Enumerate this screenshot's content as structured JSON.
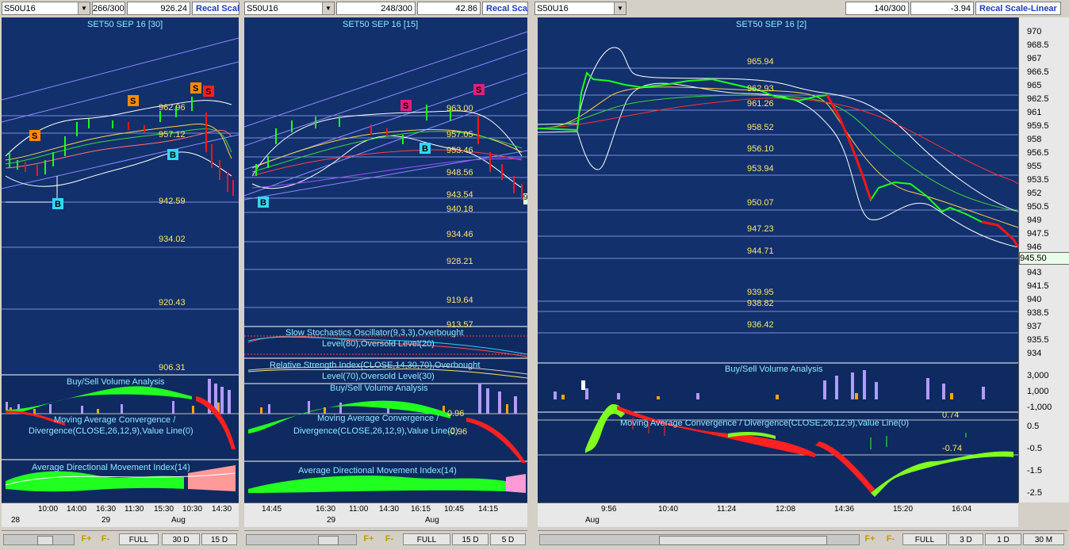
{
  "panels": [
    {
      "symbol": "S50U16",
      "count": "266/300",
      "last": "926.24",
      "recal": "Recal Scale",
      "title": "SET50 SEP 16  [30]",
      "levels": [
        "962.96",
        "957.12",
        "942.59",
        "934.02",
        "920.43",
        "906.31"
      ],
      "signals": [
        "S",
        "S",
        "S",
        "S",
        "B",
        "B"
      ],
      "sub1": "Buy/Sell Volume Analysis",
      "sub2a": "Moving Average Convergence /",
      "sub2b": "Divergence(CLOSE,26,12,9),Value Line(0)",
      "sub3": "Average Directional Movement Index(14)",
      "times": [
        "10:00",
        "14:00",
        "16:30",
        "11:30",
        "15:30",
        "10:30",
        "14:30"
      ],
      "dates": [
        "28",
        "29",
        "Aug"
      ],
      "buttons": [
        "FULL",
        "30 D",
        "15 D"
      ]
    },
    {
      "symbol": "S50U16",
      "count": "248/300",
      "last": "42.86",
      "recal": "Recal Scale",
      "title": "SET50 SEP 16  [15]",
      "levels": [
        "963.00",
        "957.05",
        "953.46",
        "948.56",
        "943.54",
        "940.18",
        "934.46",
        "928.21",
        "919.64",
        "913.57"
      ],
      "signals": [
        "S",
        "S",
        "B",
        "B"
      ],
      "stoch_a": "Slow Stochastics Oscillator(9,3,3),Overbought",
      "stoch_b": "Level(80),Oversold Level(20)",
      "rsi_a": "Relative Strength Index(CLOSE,14,30,70),Overbought",
      "rsi_b": "Level(70),Oversold Level(30)",
      "sub1": "Buy/Sell Volume Analysis",
      "sub2a": "Moving Average Convergence /",
      "sub2b": "Divergence(CLOSE,26,12,9),Value Line(0)",
      "macd_vals": [
        "0.96",
        "-0.96"
      ],
      "sub3": "Average Directional Movement Index(14)",
      "edge_val": "9",
      "times": [
        "14:45",
        "16:30",
        "11:00",
        "14:30",
        "16:15",
        "10:45",
        "14:15"
      ],
      "dates": [
        "29",
        "Aug"
      ],
      "buttons": [
        "FULL",
        "15 D",
        "5 D"
      ]
    },
    {
      "symbol": "S50U16",
      "count": "140/300",
      "last": "-3.94",
      "recal": "Recal Scale-Linear",
      "title": "SET50 SEP 16  [2]",
      "levels": [
        "965.94",
        "962.93",
        "961.26",
        "958.52",
        "956.10",
        "953.94",
        "950.07",
        "947.23",
        "944.71",
        "939.95",
        "938.82",
        "936.42"
      ],
      "price_axis": [
        "970",
        "968.5",
        "967",
        "966.5",
        "965",
        "964",
        "962.5",
        "961",
        "959.5",
        "958",
        "956.5",
        "955",
        "953.5",
        "952",
        "950.5",
        "949",
        "947.5",
        "946",
        "943",
        "941.5",
        "940",
        "938.5",
        "937",
        "935.5",
        "934"
      ],
      "current_price": "945.50",
      "sub1": "Buy/Sell Volume Analysis",
      "vol_axis": [
        "3,000",
        "1,000",
        "-1,000"
      ],
      "sub2": "Moving Average Convergence / Divergence(CLOSE,26,12,9),Value Line(0)",
      "macd_vals": [
        "0.74",
        "-0.74"
      ],
      "macd_axis": [
        "0.5",
        "-0.5",
        "-1.5",
        "-2.5"
      ],
      "times": [
        "9:56",
        "10:40",
        "11:24",
        "12:08",
        "14:36",
        "15:20",
        "16:04"
      ],
      "dates": [
        "Aug"
      ],
      "buttons": [
        "FULL",
        "3 D",
        "1 D",
        "30 M"
      ]
    }
  ],
  "fbuttons": [
    "F+",
    "F-"
  ],
  "colors": {
    "bg": "#12306c",
    "level": "#ffe566",
    "title": "#8fe8ff",
    "up": "#19ff19",
    "down": "#ff1414"
  }
}
